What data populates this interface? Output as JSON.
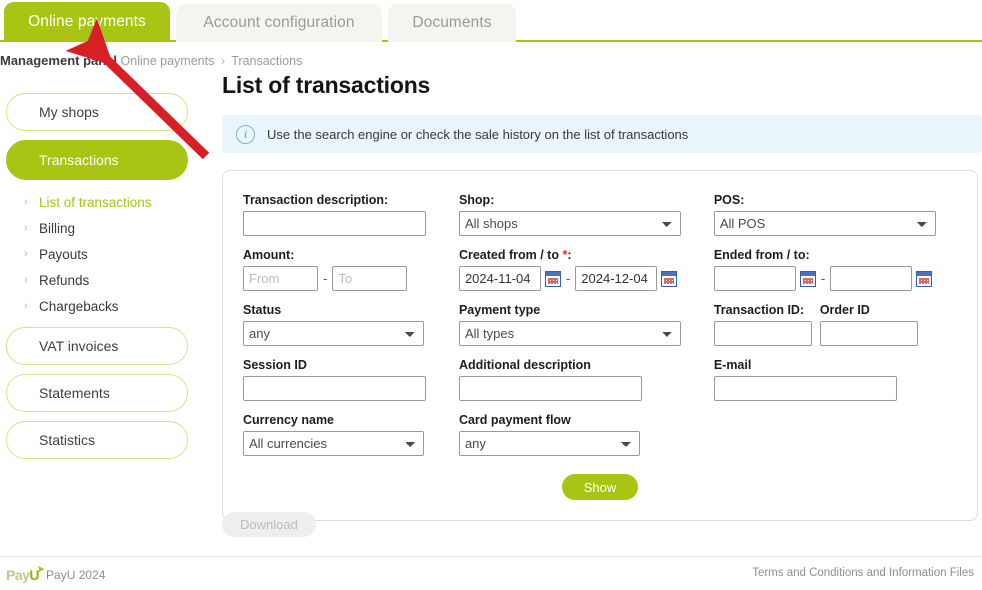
{
  "tabs": [
    {
      "id": "online-payments",
      "label": "Online payments",
      "active": true
    },
    {
      "id": "account-configuration",
      "label": "Account configuration",
      "active": false
    },
    {
      "id": "documents",
      "label": "Documents",
      "active": false
    }
  ],
  "breadcrumb": {
    "root": "Management panel",
    "level1": "Online payments",
    "separator": "›",
    "level2": "Transactions"
  },
  "sidebar": {
    "pills_top": [
      {
        "id": "my-shops",
        "label": "My shops",
        "active": false
      },
      {
        "id": "transactions",
        "label": "Transactions",
        "active": true
      }
    ],
    "sub_items": [
      {
        "id": "list-of-transactions",
        "label": "List of transactions",
        "selected": true
      },
      {
        "id": "billing",
        "label": "Billing",
        "selected": false
      },
      {
        "id": "payouts",
        "label": "Payouts",
        "selected": false
      },
      {
        "id": "refunds",
        "label": "Refunds",
        "selected": false
      },
      {
        "id": "chargebacks",
        "label": "Chargebacks",
        "selected": false
      }
    ],
    "pills_bottom": [
      {
        "id": "vat-invoices",
        "label": "VAT invoices"
      },
      {
        "id": "statements",
        "label": "Statements"
      },
      {
        "id": "statistics",
        "label": "Statistics"
      }
    ]
  },
  "main": {
    "page_title": "List of transactions",
    "info_banner": {
      "icon": "info-icon",
      "text": "Use the search engine or check the sale history on the list of transactions"
    }
  },
  "form": {
    "transaction_description": {
      "label": "Transaction description:",
      "value": "",
      "placeholder": ""
    },
    "amount": {
      "label": "Amount:",
      "from_placeholder": "From",
      "to_placeholder": "To",
      "from_value": "",
      "to_value": "",
      "separator": "-"
    },
    "status": {
      "label": "Status",
      "value": "any"
    },
    "session_id": {
      "label": "Session ID",
      "value": ""
    },
    "currency_name": {
      "label": "Currency name",
      "value": "All currencies"
    },
    "shop": {
      "label": "Shop:",
      "value": "All shops"
    },
    "created_from_to": {
      "label": "Created from / to ",
      "required_mark": "*",
      "label_suffix": ":",
      "from_value": "2024-11-04",
      "to_value": "2024-12-04",
      "separator": "-"
    },
    "payment_type": {
      "label": "Payment type",
      "value": "All types"
    },
    "additional_description": {
      "label": "Additional description",
      "value": ""
    },
    "card_payment_flow": {
      "label": "Card payment flow",
      "value": "any"
    },
    "pos": {
      "label": "POS:",
      "value": "All POS"
    },
    "ended_from_to": {
      "label": "Ended from / to:",
      "from_value": "",
      "to_value": "",
      "separator": "-"
    },
    "transaction_id": {
      "label": "Transaction ID:",
      "value": ""
    },
    "order_id": {
      "label": "Order ID",
      "value": ""
    },
    "email": {
      "label": "E-mail",
      "value": ""
    },
    "show_button": "Show"
  },
  "download_button": "Download",
  "footer": {
    "logo_part1": "Pay",
    "logo_part2": "U",
    "copyright": "PayU 2024",
    "terms_link": "Terms and Conditions and Information Files"
  },
  "colors": {
    "brand_green": "#a9c413",
    "info_bg": "#e9f5fb",
    "annotation_red": "#d81f26",
    "tab_inactive_bg": "#f4f4f0"
  }
}
